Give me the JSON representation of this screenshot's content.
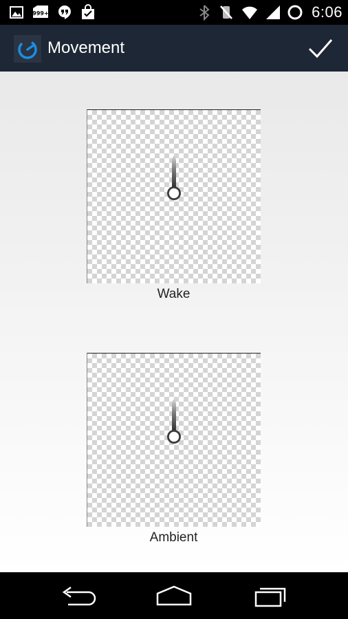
{
  "status_bar": {
    "time": "6:06",
    "left_icons": [
      "gallery-icon",
      "notification-count-icon",
      "hangouts-icon",
      "store-bag-icon"
    ],
    "notification_badge": "999+",
    "right_icons": [
      "bluetooth-icon",
      "vibrate-off-icon",
      "wifi-icon",
      "signal-icon",
      "battery-icon"
    ]
  },
  "action_bar": {
    "title": "Movement",
    "app_icon": "app-logo-icon",
    "confirm_icon": "checkmark-icon",
    "background_color": "#1e2735",
    "accent_color": "#1a8fe3"
  },
  "hands": [
    {
      "label": "Wake"
    },
    {
      "label": "Ambient"
    }
  ],
  "nav_bar": {
    "icons": [
      "back-icon",
      "home-icon",
      "recent-apps-icon"
    ]
  }
}
